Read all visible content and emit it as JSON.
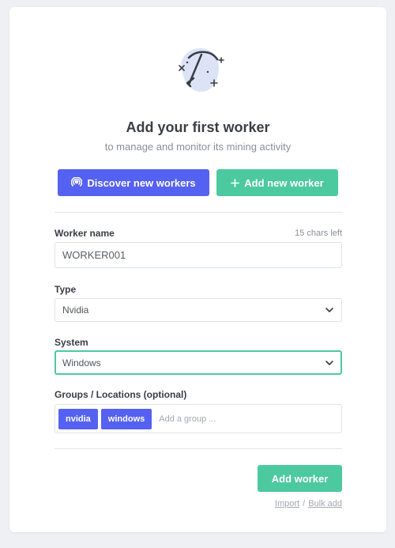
{
  "header": {
    "title": "Add your first worker",
    "subtitle": "to manage and monitor its mining activity"
  },
  "actions": {
    "discover_label": "Discover new workers",
    "add_new_label": "Add new worker"
  },
  "form": {
    "worker_name": {
      "label": "Worker name",
      "chars_left": "15 chars left",
      "value": "WORKER001"
    },
    "type": {
      "label": "Type",
      "selected": "Nvidia"
    },
    "system": {
      "label": "System",
      "selected": "Windows"
    },
    "groups": {
      "label": "Groups / Locations (optional)",
      "tags": [
        "nvidia",
        "windows"
      ],
      "placeholder": "Add a group ..."
    },
    "submit_label": "Add worker"
  },
  "footer": {
    "import_label": "Import",
    "separator": "/",
    "bulk_add_label": "Bulk add"
  },
  "colors": {
    "primary_blue": "#5561f0",
    "primary_green": "#4dc99f",
    "illustration_blob": "#dde3f7"
  },
  "icons": {
    "illustration": "pickaxe-icon",
    "discover": "broadcast-icon",
    "add": "plus-icon",
    "dropdown": "chevron-down-icon"
  }
}
